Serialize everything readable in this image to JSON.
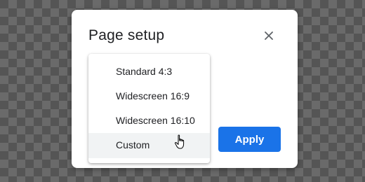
{
  "dialog": {
    "title": "Page setup",
    "close_icon": "close-icon"
  },
  "dropdown": {
    "options": [
      {
        "label": "Standard 4:3"
      },
      {
        "label": "Widescreen 16:9"
      },
      {
        "label": "Widescreen 16:10"
      },
      {
        "label": "Custom"
      }
    ],
    "hovered_index": 3
  },
  "buttons": {
    "apply_label": "Apply"
  },
  "colors": {
    "accent": "#1a73e8",
    "hover_bg": "#f1f3f4"
  },
  "cursor": {
    "icon": "hand-pointer-icon"
  }
}
